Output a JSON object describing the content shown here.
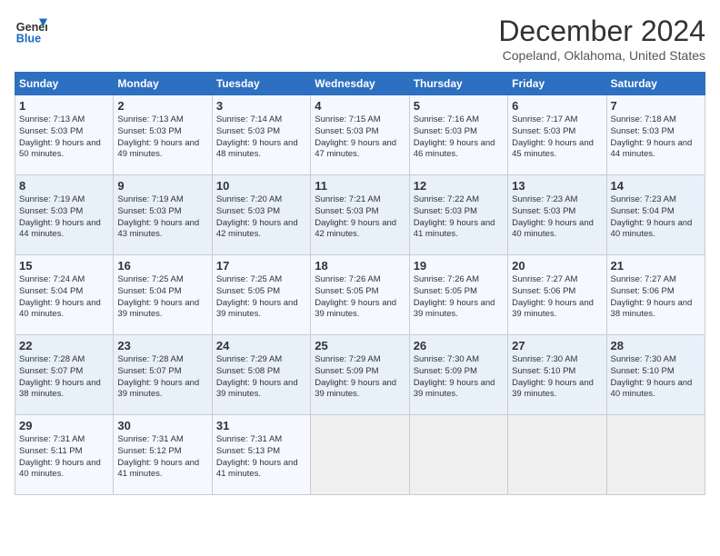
{
  "logo": {
    "line1": "General",
    "line2": "Blue"
  },
  "title": "December 2024",
  "subtitle": "Copeland, Oklahoma, United States",
  "days_of_week": [
    "Sunday",
    "Monday",
    "Tuesday",
    "Wednesday",
    "Thursday",
    "Friday",
    "Saturday"
  ],
  "weeks": [
    [
      {
        "day": 1,
        "sunrise": "7:13 AM",
        "sunset": "5:03 PM",
        "daylight": "9 hours and 50 minutes."
      },
      {
        "day": 2,
        "sunrise": "7:13 AM",
        "sunset": "5:03 PM",
        "daylight": "9 hours and 49 minutes."
      },
      {
        "day": 3,
        "sunrise": "7:14 AM",
        "sunset": "5:03 PM",
        "daylight": "9 hours and 48 minutes."
      },
      {
        "day": 4,
        "sunrise": "7:15 AM",
        "sunset": "5:03 PM",
        "daylight": "9 hours and 47 minutes."
      },
      {
        "day": 5,
        "sunrise": "7:16 AM",
        "sunset": "5:03 PM",
        "daylight": "9 hours and 46 minutes."
      },
      {
        "day": 6,
        "sunrise": "7:17 AM",
        "sunset": "5:03 PM",
        "daylight": "9 hours and 45 minutes."
      },
      {
        "day": 7,
        "sunrise": "7:18 AM",
        "sunset": "5:03 PM",
        "daylight": "9 hours and 44 minutes."
      }
    ],
    [
      {
        "day": 8,
        "sunrise": "7:19 AM",
        "sunset": "5:03 PM",
        "daylight": "9 hours and 44 minutes."
      },
      {
        "day": 9,
        "sunrise": "7:19 AM",
        "sunset": "5:03 PM",
        "daylight": "9 hours and 43 minutes."
      },
      {
        "day": 10,
        "sunrise": "7:20 AM",
        "sunset": "5:03 PM",
        "daylight": "9 hours and 42 minutes."
      },
      {
        "day": 11,
        "sunrise": "7:21 AM",
        "sunset": "5:03 PM",
        "daylight": "9 hours and 42 minutes."
      },
      {
        "day": 12,
        "sunrise": "7:22 AM",
        "sunset": "5:03 PM",
        "daylight": "9 hours and 41 minutes."
      },
      {
        "day": 13,
        "sunrise": "7:23 AM",
        "sunset": "5:03 PM",
        "daylight": "9 hours and 40 minutes."
      },
      {
        "day": 14,
        "sunrise": "7:23 AM",
        "sunset": "5:04 PM",
        "daylight": "9 hours and 40 minutes."
      }
    ],
    [
      {
        "day": 15,
        "sunrise": "7:24 AM",
        "sunset": "5:04 PM",
        "daylight": "9 hours and 40 minutes."
      },
      {
        "day": 16,
        "sunrise": "7:25 AM",
        "sunset": "5:04 PM",
        "daylight": "9 hours and 39 minutes."
      },
      {
        "day": 17,
        "sunrise": "7:25 AM",
        "sunset": "5:05 PM",
        "daylight": "9 hours and 39 minutes."
      },
      {
        "day": 18,
        "sunrise": "7:26 AM",
        "sunset": "5:05 PM",
        "daylight": "9 hours and 39 minutes."
      },
      {
        "day": 19,
        "sunrise": "7:26 AM",
        "sunset": "5:05 PM",
        "daylight": "9 hours and 39 minutes."
      },
      {
        "day": 20,
        "sunrise": "7:27 AM",
        "sunset": "5:06 PM",
        "daylight": "9 hours and 39 minutes."
      },
      {
        "day": 21,
        "sunrise": "7:27 AM",
        "sunset": "5:06 PM",
        "daylight": "9 hours and 38 minutes."
      }
    ],
    [
      {
        "day": 22,
        "sunrise": "7:28 AM",
        "sunset": "5:07 PM",
        "daylight": "9 hours and 38 minutes."
      },
      {
        "day": 23,
        "sunrise": "7:28 AM",
        "sunset": "5:07 PM",
        "daylight": "9 hours and 39 minutes."
      },
      {
        "day": 24,
        "sunrise": "7:29 AM",
        "sunset": "5:08 PM",
        "daylight": "9 hours and 39 minutes."
      },
      {
        "day": 25,
        "sunrise": "7:29 AM",
        "sunset": "5:09 PM",
        "daylight": "9 hours and 39 minutes."
      },
      {
        "day": 26,
        "sunrise": "7:30 AM",
        "sunset": "5:09 PM",
        "daylight": "9 hours and 39 minutes."
      },
      {
        "day": 27,
        "sunrise": "7:30 AM",
        "sunset": "5:10 PM",
        "daylight": "9 hours and 39 minutes."
      },
      {
        "day": 28,
        "sunrise": "7:30 AM",
        "sunset": "5:10 PM",
        "daylight": "9 hours and 40 minutes."
      }
    ],
    [
      {
        "day": 29,
        "sunrise": "7:31 AM",
        "sunset": "5:11 PM",
        "daylight": "9 hours and 40 minutes."
      },
      {
        "day": 30,
        "sunrise": "7:31 AM",
        "sunset": "5:12 PM",
        "daylight": "9 hours and 41 minutes."
      },
      {
        "day": 31,
        "sunrise": "7:31 AM",
        "sunset": "5:13 PM",
        "daylight": "9 hours and 41 minutes."
      },
      null,
      null,
      null,
      null
    ]
  ]
}
